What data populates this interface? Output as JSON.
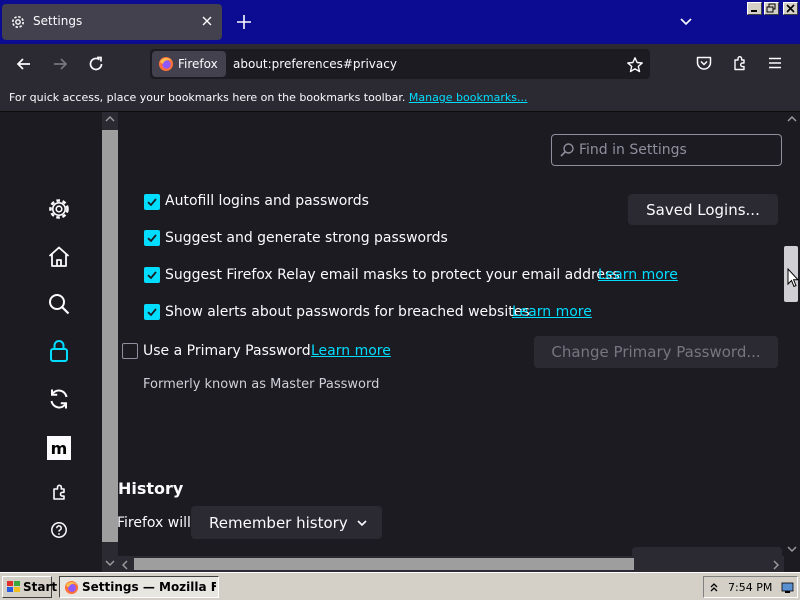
{
  "tab": {
    "title": "Settings"
  },
  "navbar": {
    "identity_label": "Firefox",
    "url": "about:preferences#privacy"
  },
  "bookmarks_bar": {
    "message": "For quick access, place your bookmarks here on the bookmarks toolbar. ",
    "link": "Manage bookmarks..."
  },
  "search": {
    "placeholder": "Find in Settings"
  },
  "passwords": {
    "autofill": {
      "label": "Autofill logins and passwords",
      "checked": true
    },
    "suggest": {
      "label": "Suggest and generate strong passwords",
      "checked": true
    },
    "relay": {
      "label": "Suggest Firefox Relay email masks to protect your email address",
      "checked": true,
      "link": "Learn more"
    },
    "breach": {
      "label": "Show alerts about passwords for breached websites",
      "checked": true,
      "link": "Learn more"
    },
    "primary": {
      "label": "Use a Primary Password",
      "checked": false,
      "link": "Learn more"
    },
    "formerly": "Formerly known as Master Password",
    "saved_logins_button": "Saved Logins...",
    "change_primary_button": "Change Primary Password..."
  },
  "history": {
    "heading": "History",
    "firefox_will": "Firefox will",
    "select_value": "Remember history"
  },
  "sidebar_icons": [
    "gear-icon",
    "home-icon",
    "search-icon",
    "lock-icon",
    "sync-icon",
    "mozilla-icon",
    "extensions-icon",
    "help-icon"
  ],
  "taskbar": {
    "start": "Start",
    "task": "Settings — Mozilla Firefox",
    "clock": "7:54 PM"
  },
  "colors": {
    "accent": "#00ddff",
    "tabstrip": "#0c0c93",
    "background": "#1c1b22"
  }
}
